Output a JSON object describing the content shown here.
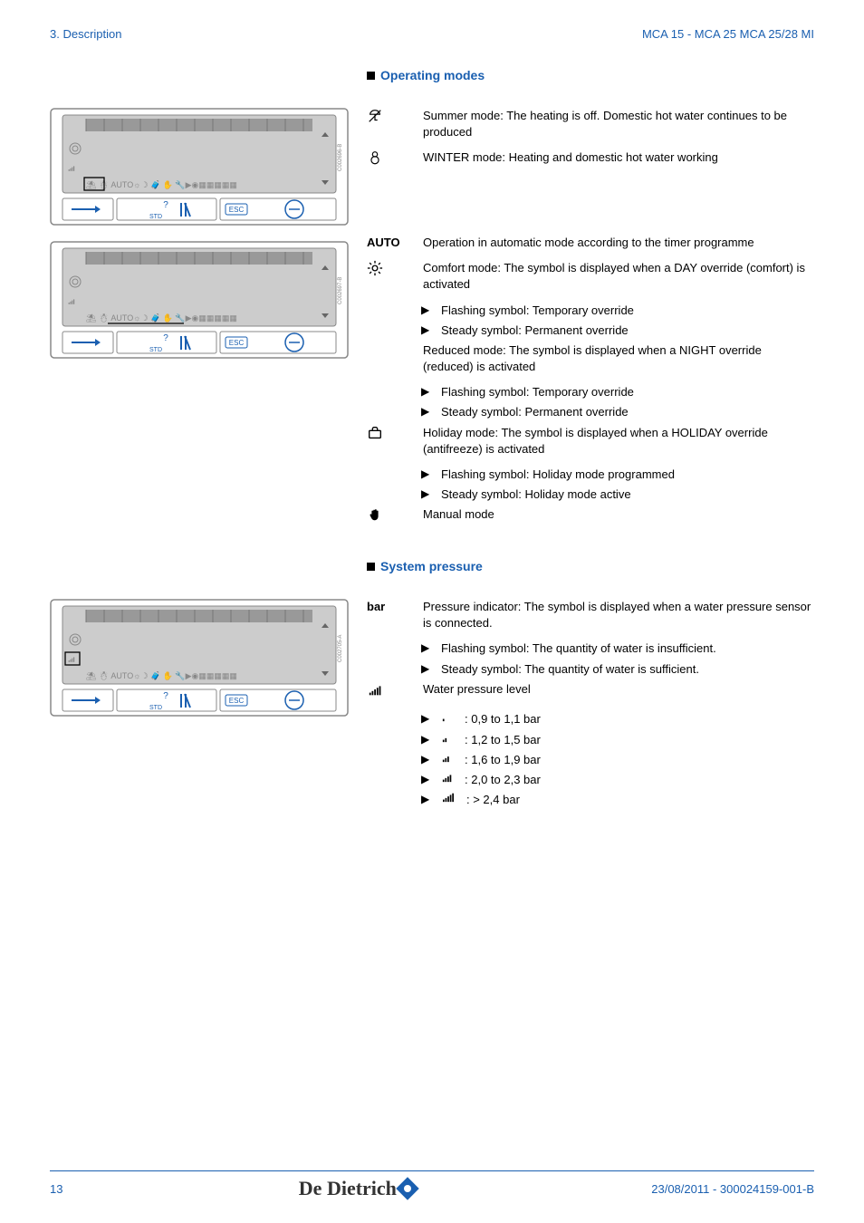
{
  "header": {
    "left": "3.  Description",
    "right": "MCA 15 - MCA 25 MCA 25/28 MI"
  },
  "section_operating_modes": {
    "title": "Operating modes",
    "items": [
      {
        "term_svg": "summer",
        "desc": "Summer mode: The heating is off. Domestic hot water continues to be produced"
      },
      {
        "term_svg": "winter",
        "desc": "WINTER mode: Heating and domestic hot water working"
      }
    ],
    "auto_items": [
      {
        "term_text": "AUTO",
        "term_class": "auto-bold",
        "desc": "Operation in automatic mode according to the timer programme"
      },
      {
        "term_svg": "sun",
        "desc": "Comfort mode: The symbol is displayed when a DAY override (comfort) is activated",
        "sub": [
          "Flashing symbol: Temporary override",
          "Steady symbol: Permanent override"
        ]
      },
      {
        "term_svg": "moon",
        "desc": "Reduced mode: The symbol is displayed when a NIGHT override (reduced) is activated",
        "sub": [
          "Flashing symbol: Temporary override",
          "Steady symbol: Permanent override"
        ]
      },
      {
        "term_svg": "suitcase",
        "desc": "Holiday mode: The symbol is displayed when a HOLIDAY override (antifreeze) is activated",
        "sub": [
          "Flashing symbol: Holiday mode programmed",
          "Steady symbol: Holiday mode active"
        ]
      },
      {
        "term_svg": "hand",
        "desc": "Manual mode"
      }
    ]
  },
  "section_system_pressure": {
    "title": "System pressure",
    "items": [
      {
        "term_text": "bar",
        "term_class": "auto-bold",
        "desc": "Pressure indicator: The symbol is displayed when a water pressure sensor is connected.",
        "sub": [
          "Flashing symbol: The quantity of water is insufficient.",
          "Steady symbol: The quantity of water is sufficient."
        ]
      },
      {
        "term_svg": "bars5",
        "desc": "Water pressure level",
        "sub_special": [
          {
            "sym": "l",
            "text": ": 0,9 to 1,1 bar"
          },
          {
            "sym": "xl",
            "text": ": 1,2 to 1,5 bar"
          },
          {
            "sym": "xxl",
            "text": ": 1,6 to 1,9 bar"
          },
          {
            "sym": "xxxl",
            "text": ": 2,0 to 2,3 bar"
          },
          {
            "sym": "xxxxl",
            "text": ": > 2,4 bar"
          }
        ]
      }
    ]
  },
  "footer": {
    "page": "13",
    "logo": "De Dietrich",
    "date": "23/08/2011  - 300024159-001-B"
  },
  "panel_captions": {
    "p1": "C002696-B",
    "p2": "C002697-B",
    "p3": "C002705-A"
  },
  "chart_data": null
}
